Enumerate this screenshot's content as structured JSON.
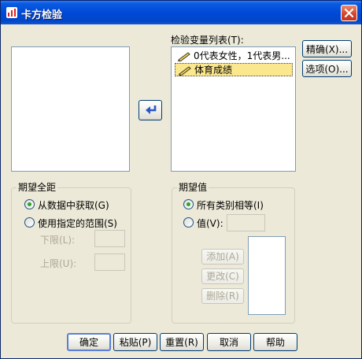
{
  "window": {
    "title": "卡方检验"
  },
  "target_list": {
    "label": "检验变量列表(T):",
    "items": [
      {
        "label": "0代表女性，1代表男..."
      },
      {
        "label": "体育成绩"
      }
    ]
  },
  "side_buttons": {
    "exact": "精确(X)...",
    "options": "选项(O)..."
  },
  "expected_range": {
    "legend": "期望全距",
    "from_data": "从数据中获取(G)",
    "use_range": "使用指定的范围(S)",
    "lower_label": "下限(L):",
    "upper_label": "上限(U):",
    "selected": "from_data"
  },
  "expected_values": {
    "legend": "期望值",
    "all_equal": "所有类别相等(I)",
    "values_label": "值(V):",
    "add": "添加(A)",
    "change": "更改(C)",
    "remove": "删除(R)",
    "selected": "all_equal"
  },
  "footer": {
    "ok": "确定",
    "paste": "粘贴(P)",
    "reset": "重置(R)",
    "cancel": "取消",
    "help": "帮助"
  },
  "colors": {
    "title_bar": "#0049d8",
    "selection": "#fbe78e",
    "radio_dot": "#2ba32e"
  }
}
